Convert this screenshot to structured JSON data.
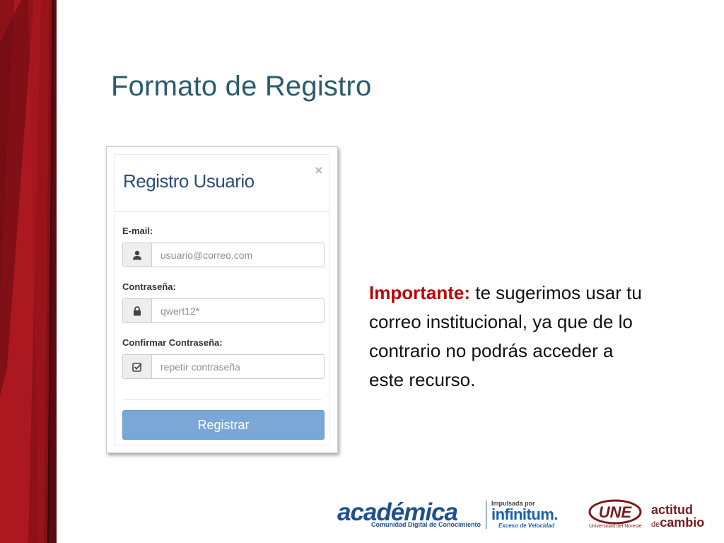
{
  "slide": {
    "title": "Formato de Registro"
  },
  "modal": {
    "title": "Registro Usuario",
    "close_symbol": "×",
    "fields": [
      {
        "label": "E-mail:",
        "placeholder": "usuario@correo.com",
        "icon": "user-icon"
      },
      {
        "label": "Contraseña:",
        "placeholder": "qwert12*",
        "icon": "lock-icon"
      },
      {
        "label": "Confirmar Contraseña:",
        "placeholder": "repetir contraseña",
        "icon": "check-square-icon"
      }
    ],
    "submit_label": "Registrar"
  },
  "note": {
    "emphasis": "Importante:",
    "text": " te sugerimos usar tu correo institucional, ya que de lo contrario no podrás acceder a este recurso."
  },
  "footer": {
    "academica": {
      "word": "académica",
      "tagline": "Comunidad Digital de Conocimiento"
    },
    "infinitum": {
      "top": "Impulsada por",
      "word": "infinitum.",
      "tagline": "Exceso de Velocidad"
    },
    "une": {
      "word": "UNE",
      "tagline": "Universidad del Noreste"
    },
    "actitud": {
      "line1": "actitud",
      "line2_small": "de",
      "line2": "cambio"
    }
  },
  "colors": {
    "title": "#2b5b6e",
    "emphasis": "#c00000",
    "button": "#7ba7d6",
    "band_dark": "#5a0a10",
    "band_red": "#b11a22"
  }
}
